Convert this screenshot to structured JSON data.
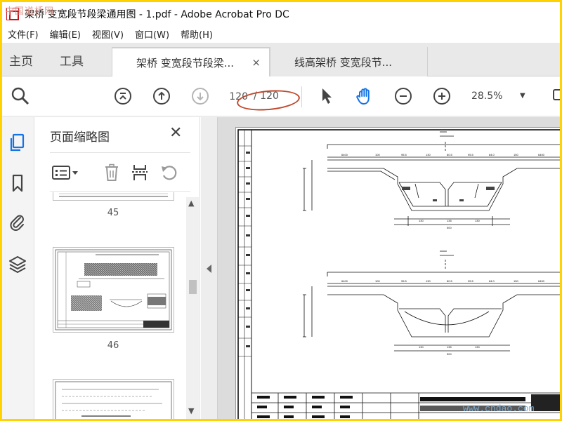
{
  "window": {
    "title": "架桥 变宽段节段梁通用图 - 1.pdf - Adobe Acrobat Pro DC"
  },
  "menu": [
    "文件(F)",
    "编辑(E)",
    "视图(V)",
    "窗口(W)",
    "帮助(H)"
  ],
  "tabs": {
    "home": "主页",
    "tools": "工具",
    "documents": [
      {
        "label": "架桥 变宽段节段梁...",
        "active": true,
        "close": "×"
      },
      {
        "label": "线高架桥 变宽段节...",
        "active": false
      }
    ]
  },
  "toolbar": {
    "current_page": "120",
    "total_pages": "/ 120",
    "zoom": "28.5%",
    "icons": [
      "search-zoom-icon",
      "first-page-icon",
      "previous-page-icon",
      "next-page-icon",
      "select-arrow-icon",
      "hand-icon",
      "zoom-out-icon",
      "zoom-in-icon"
    ]
  },
  "left_rail": {
    "icons": [
      "page-thumbnails-icon",
      "bookmark-icon",
      "attachment-icon",
      "layers-icon"
    ]
  },
  "thumbnail_panel": {
    "title": "页面缩略图",
    "close": "✕",
    "thumbnails": [
      {
        "label": "45"
      },
      {
        "label": "46"
      }
    ]
  },
  "accent_colors": {
    "active_blue": "#1473e6",
    "annotation_red": "#c0492b",
    "frame_yellow": "#ffd200"
  },
  "watermarks": {
    "corner": "中国道桥网",
    "bottom": "www.cndao.com"
  }
}
